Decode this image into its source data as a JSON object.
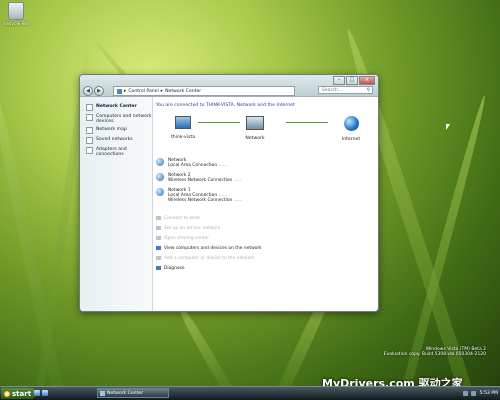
{
  "desktop": {
    "recycle_bin_label": "Recycle Bin",
    "vista_info_line1": "Windows Vista (TM) Beta 2",
    "vista_info_line2": "Evaluation copy. Build 5308.vbl.050304-2120",
    "watermark": "MyDrivers.com 驱动之家"
  },
  "window": {
    "address_root": "Control Panel",
    "address_current": "Network Center",
    "search_placeholder": "Search...",
    "sidebar": [
      {
        "label": "Network Center",
        "selected": true
      },
      {
        "label": "Computers and network devices",
        "selected": false
      },
      {
        "label": "Network map",
        "selected": false
      },
      {
        "label": "Saved networks",
        "selected": false
      },
      {
        "label": "Adapters and connections",
        "selected": false
      }
    ],
    "connection_status": "You are connected to THINK-VISTA, Network and the Internet",
    "map": {
      "computer": "think-vista",
      "network": "Network",
      "internet": "Internet"
    },
    "networks": [
      {
        "name": "Network",
        "conn1": "Local Area Connection",
        "dots1": "......",
        "conn2": "",
        "dots2": ""
      },
      {
        "name": "Network 2",
        "conn1": "Wireless Network Connection",
        "dots1": "......",
        "conn2": "",
        "dots2": ""
      },
      {
        "name": "Network 1",
        "conn1": "Local Area Connection",
        "dots1": "......",
        "conn2": "Wireless Network Connection",
        "dots2": "......"
      }
    ],
    "tasks": [
      {
        "label": "Connect to work",
        "enabled": false
      },
      {
        "label": "Set up an ad hoc network",
        "enabled": false
      },
      {
        "label": "Open sharing center",
        "enabled": false
      },
      {
        "label": "View computers and devices on the network",
        "enabled": true
      },
      {
        "label": "Add a computer or device to the network",
        "enabled": false
      },
      {
        "label": "Diagnose",
        "enabled": true
      }
    ]
  },
  "taskbar": {
    "start_label": "start",
    "open_window": "Network Center",
    "clock": "5:53 PM"
  }
}
